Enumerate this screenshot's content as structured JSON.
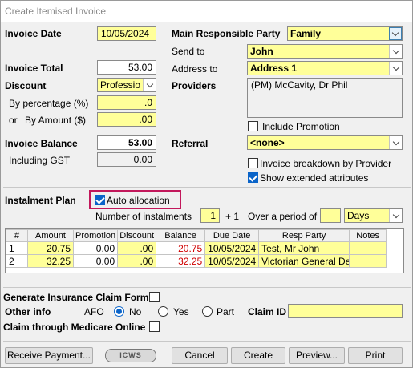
{
  "window": {
    "title": "Create Itemised Invoice"
  },
  "invoice": {
    "date_label": "Invoice Date",
    "date": "10/05/2024",
    "total_label": "Invoice Total",
    "total": "53.00",
    "discount_label": "Discount",
    "discount_value": "Professio",
    "by_percentage_label": "By percentage (%)",
    "by_percentage": ".0",
    "or_label": "or",
    "by_amount_label": "By Amount ($)",
    "by_amount": ".00",
    "balance_label": "Invoice Balance",
    "balance": "53.00",
    "gst_label": "Including GST",
    "gst": "0.00"
  },
  "party": {
    "main_label": "Main Responsible Party",
    "main_value": "Family",
    "send_to_label": "Send to",
    "send_to_value": "John",
    "address_label": "Address to",
    "address_value": "Address 1",
    "providers_label": "Providers",
    "providers_value": "(PM) McCavity, Dr Phil",
    "include_promotion_label": "Include Promotion",
    "referral_label": "Referral",
    "referral_value": "<none>",
    "breakdown_label": "Invoice breakdown by Provider",
    "extended_label": "Show extended attributes"
  },
  "plan": {
    "label": "Instalment Plan",
    "auto_label": "Auto allocation",
    "num_label": "Number of instalments",
    "num_value": "1",
    "plus": "+ 1",
    "period_label": "Over a period of",
    "period_value": "",
    "period_unit": "Days",
    "columns": [
      "#",
      "Amount",
      "Promotion",
      "Discount",
      "Balance",
      "Due Date",
      "Resp Party",
      "Notes"
    ],
    "rows": [
      [
        "1",
        "20.75",
        "0.00",
        ".00",
        "20.75",
        "10/05/2024",
        "Test, Mr John",
        ""
      ],
      [
        "2",
        "32.25",
        "0.00",
        ".00",
        "32.25",
        "10/05/2024",
        "Victorian General De",
        ""
      ]
    ]
  },
  "claims": {
    "generate_label": "Generate Insurance Claim Form",
    "other_label": "Other info",
    "afo_label": "AFO",
    "no_label": "No",
    "yes_label": "Yes",
    "part_label": "Part",
    "claim_id_label": "Claim ID",
    "claim_id_value": "",
    "medicare_label": "Claim through Medicare Online"
  },
  "buttons": {
    "receive": "Receive  Payment...",
    "logo": "ICWS",
    "cancel": "Cancel",
    "create": "Create",
    "preview": "Preview...",
    "print": "Print"
  },
  "colors": {
    "input_yellow": "#ffff99",
    "checkbox_blue": "#0a64c9",
    "highlight": "#c2185b",
    "negative_red": "#d00000"
  }
}
